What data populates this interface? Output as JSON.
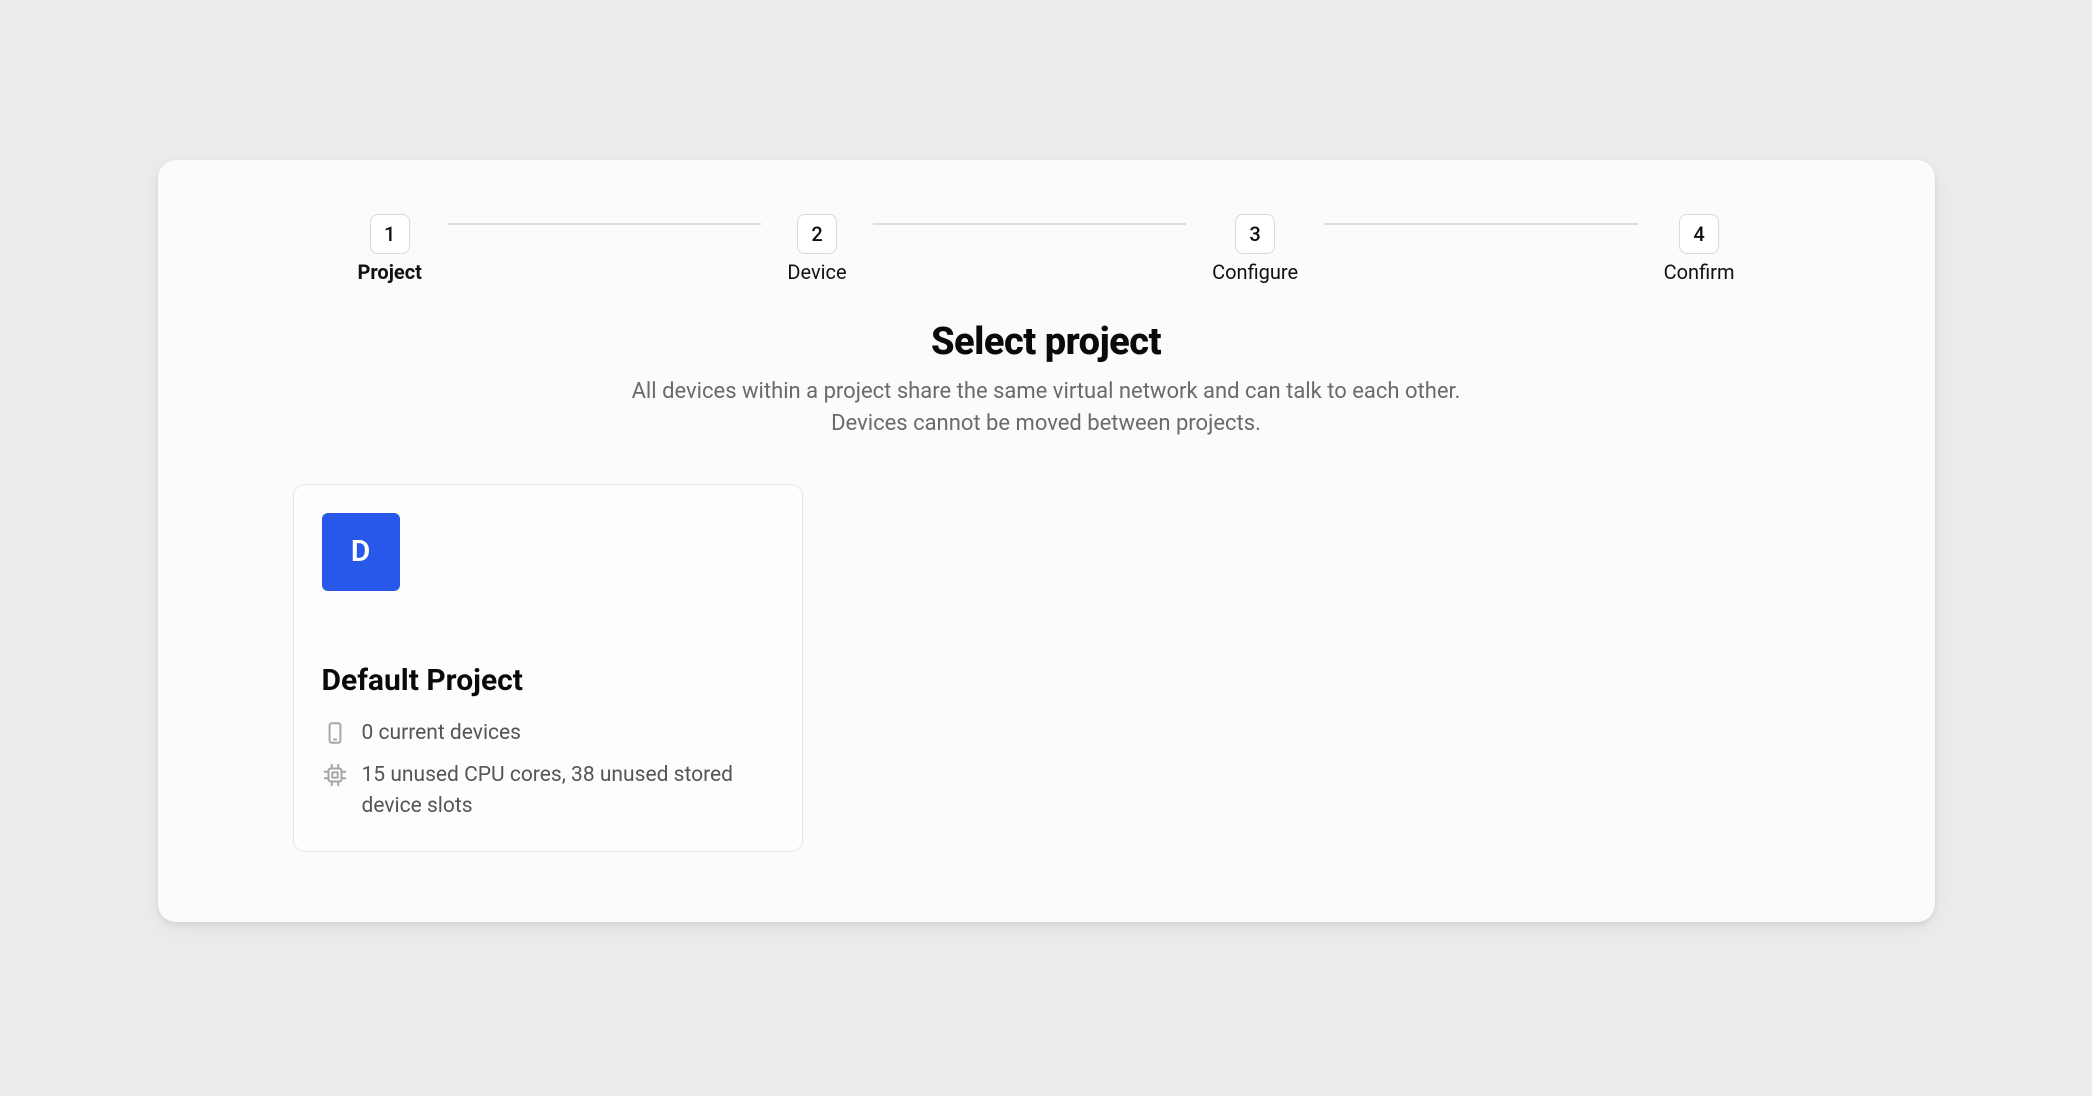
{
  "stepper": {
    "steps": [
      {
        "number": "1",
        "label": "Project",
        "active": true
      },
      {
        "number": "2",
        "label": "Device",
        "active": false
      },
      {
        "number": "3",
        "label": "Configure",
        "active": false
      },
      {
        "number": "4",
        "label": "Confirm",
        "active": false
      }
    ]
  },
  "heading": {
    "title": "Select project",
    "subtitle_line1": "All devices within a project share the same virtual network and can talk to each other.",
    "subtitle_line2": "Devices cannot be moved between projects."
  },
  "projects": [
    {
      "avatar_letter": "D",
      "avatar_color": "#2858ea",
      "name": "Default Project",
      "devices_text": "0 current devices",
      "resources_text": "15 unused CPU cores, 38 unused stored device slots"
    }
  ]
}
